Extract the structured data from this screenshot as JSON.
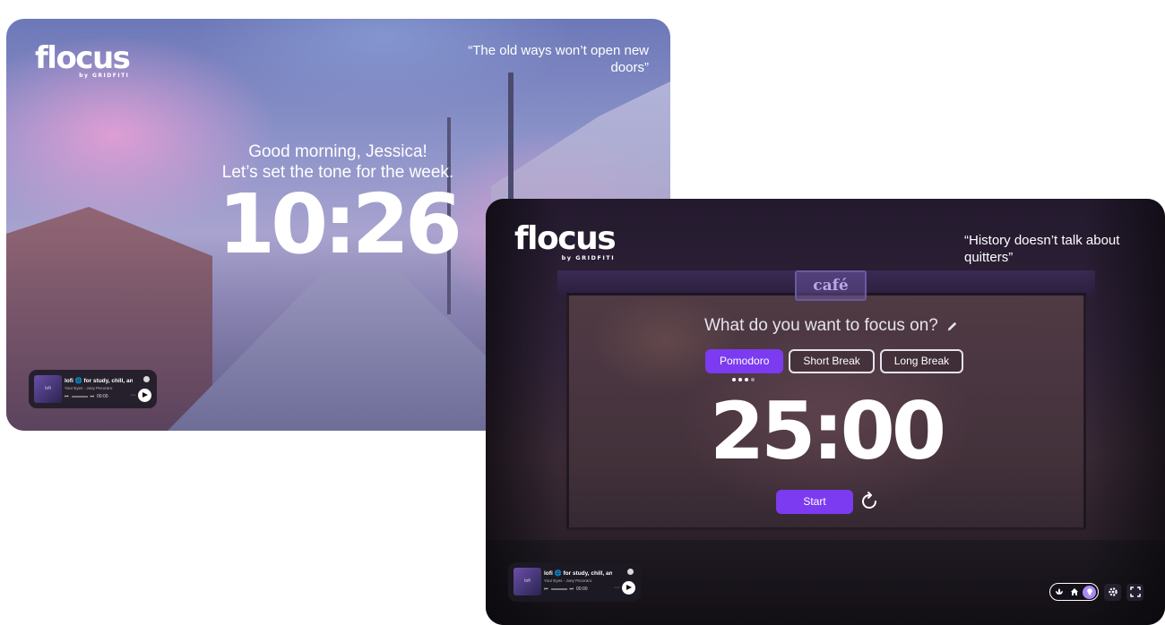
{
  "brand": {
    "name": "flocus",
    "byline": "by GRIDFITI"
  },
  "screen_morning": {
    "quote": "“The old ways won’t open new doors”",
    "greeting_line1": "Good morning, Jessica!",
    "greeting_line2": "Let’s set the tone for the week.",
    "clock": "10:26",
    "player": {
      "title": "lofi 🌐 for study, chill, and",
      "artist": "Your Eyes - Joey Pecoraro",
      "time": "00:00",
      "art_label": "lofi"
    }
  },
  "screen_focus": {
    "quote": "“History doesn’t talk about quitters”",
    "sign": "café",
    "focus_prompt": "What do you want to focus on?",
    "modes": [
      "Pomodoro",
      "Short Break",
      "Long Break"
    ],
    "active_mode": "Pomodoro",
    "session_dots": {
      "completed": 3,
      "total": 4
    },
    "timer": "25:00",
    "start_label": "Start",
    "player": {
      "title": "lofi 🌐 for study, chill, and",
      "artist": "Your Eyes - Joey Pecoraro",
      "time": "00:00",
      "art_label": "lofi"
    },
    "toolbar": {
      "scene_icons": [
        "lotus-icon",
        "home-icon",
        "bulb-icon"
      ],
      "active_scene": "bulb-icon",
      "buttons": [
        "gear-icon",
        "fullscreen-icon"
      ]
    }
  },
  "colors": {
    "accent": "#7c3bf0",
    "text": "#ffffff"
  }
}
